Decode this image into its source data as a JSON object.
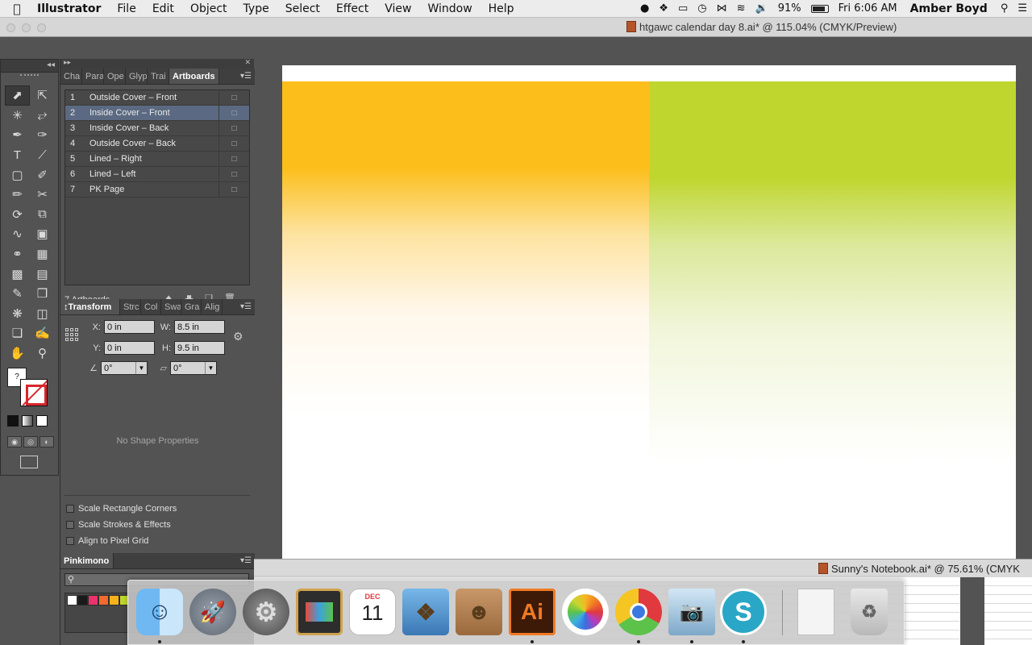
{
  "menubar": {
    "app_name": "Illustrator",
    "menus": [
      "File",
      "Edit",
      "Object",
      "Type",
      "Select",
      "Effect",
      "View",
      "Window",
      "Help"
    ],
    "battery": "91%",
    "clock": "Fri 6:06 AM",
    "user": "Amber Boyd"
  },
  "document": {
    "title": "htgawc calendar day 8.ai* @ 115.04% (CMYK/Preview)"
  },
  "panels": {
    "top_tabs": [
      "Cha",
      "Para",
      "Ope",
      "Glyp",
      "Trai",
      "Artboards"
    ],
    "artboards": {
      "items": [
        {
          "num": "1",
          "name": "Outside Cover – Front"
        },
        {
          "num": "2",
          "name": "Inside Cover – Front"
        },
        {
          "num": "3",
          "name": "Inside Cover – Back"
        },
        {
          "num": "4",
          "name": "Outside Cover – Back"
        },
        {
          "num": "5",
          "name": "Lined – Right"
        },
        {
          "num": "6",
          "name": "Lined  – Left"
        },
        {
          "num": "7",
          "name": "PK Page"
        }
      ],
      "selected_index": 1,
      "count_label": "7 Artboards"
    },
    "mid_tabs": [
      "Transform",
      "Strc",
      "Col",
      "Swa",
      "Gra",
      "Alig"
    ],
    "transform": {
      "x_label": "X:",
      "x": "0 in",
      "y_label": "Y:",
      "y": "0 in",
      "w_label": "W:",
      "w": "8.5 in",
      "h_label": "H:",
      "h": "9.5 in",
      "angle": "0°",
      "shear": "0°",
      "no_shape": "No Shape Properties",
      "options": [
        "Scale Rectangle Corners",
        "Scale Strokes & Effects",
        "Align to Pixel Grid"
      ]
    },
    "library": {
      "title": "Pinkimono",
      "swatches": [
        "#ffffff",
        "#1a1a1a",
        "#e8336d",
        "#f26a2e",
        "#f6b21a",
        "#bfd62e"
      ]
    }
  },
  "document2": {
    "title": "Sunny's Notebook.ai* @ 75.61% (CMYK"
  },
  "colors": {
    "orange_fill": "#fcbe1a",
    "green_fill": "#bfd62e",
    "selection": "#5b6a82"
  },
  "dock": {
    "calendar_month": "DEC",
    "calendar_day": "11",
    "illustrator_label": "Ai"
  }
}
